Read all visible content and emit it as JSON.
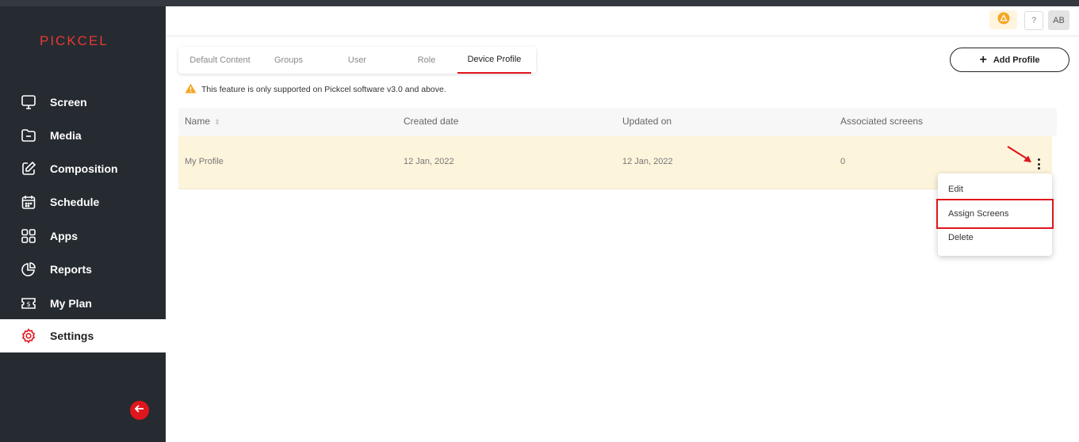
{
  "app": {
    "logo": "PICKCEL"
  },
  "sidebar": {
    "items": [
      {
        "label": "Screen",
        "icon": "monitor-icon"
      },
      {
        "label": "Media",
        "icon": "folder-icon"
      },
      {
        "label": "Composition",
        "icon": "pencil-square-icon"
      },
      {
        "label": "Schedule",
        "icon": "calendar-icon"
      },
      {
        "label": "Apps",
        "icon": "apps-grid-icon"
      },
      {
        "label": "Reports",
        "icon": "pie-chart-icon"
      },
      {
        "label": "My Plan",
        "icon": "dollar-ticket-icon"
      },
      {
        "label": "Settings",
        "icon": "gear-icon",
        "active": true
      }
    ],
    "collapse_icon": "arrow-left-icon"
  },
  "header": {
    "help_label": "?",
    "avatar_initials": "AB"
  },
  "tabs": [
    {
      "label": "Default Content"
    },
    {
      "label": "Groups"
    },
    {
      "label": "User"
    },
    {
      "label": "Role"
    },
    {
      "label": "Device Profile",
      "active": true
    }
  ],
  "actions": {
    "add_profile_label": "Add Profile"
  },
  "notice": {
    "text": "This feature is only supported on Pickcel software v3.0 and above."
  },
  "table": {
    "columns": [
      "Name",
      "Created date",
      "Updated on",
      "Associated screens"
    ],
    "rows": [
      {
        "name": "My Profile",
        "created": "12 Jan, 2022",
        "updated": "12 Jan, 2022",
        "screens": "0"
      }
    ]
  },
  "context_menu": {
    "items": [
      {
        "label": "Edit"
      },
      {
        "label": "Assign Screens",
        "highlighted": true
      },
      {
        "label": "Delete"
      }
    ]
  },
  "colors": {
    "accent": "#e0161d",
    "sidebar_bg": "#262b31",
    "row_highlight": "#fdf4dc",
    "warning": "#f5a623"
  }
}
